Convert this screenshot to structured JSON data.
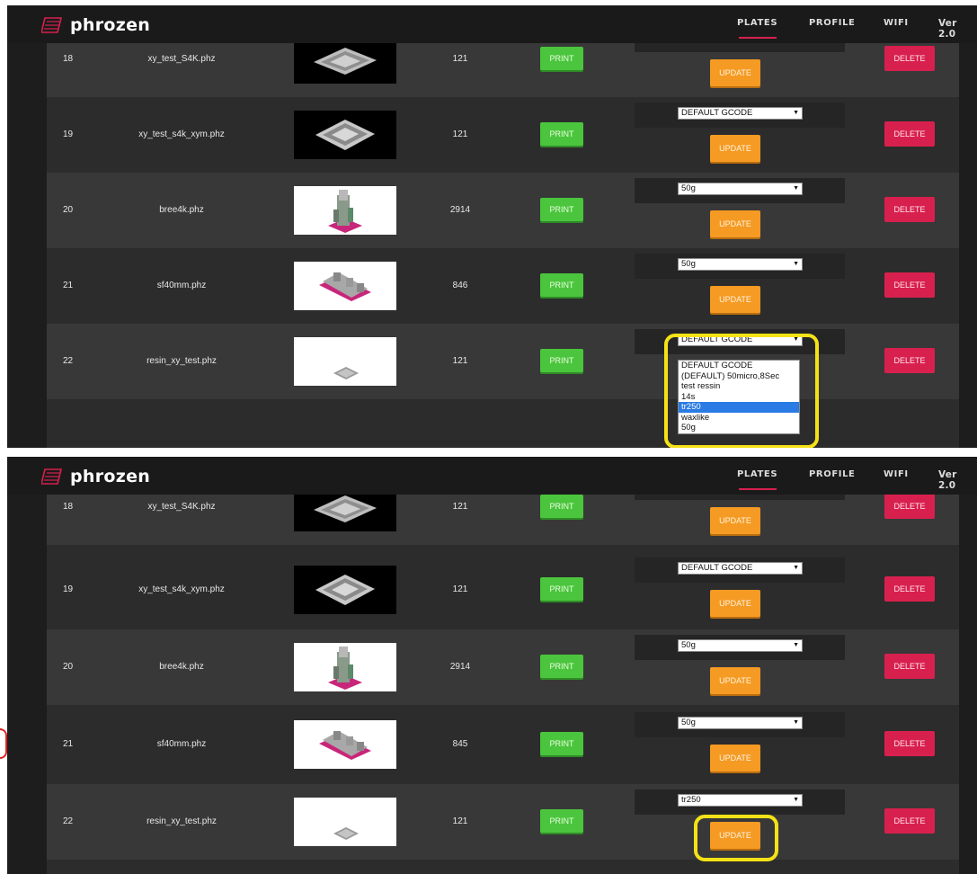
{
  "app": {
    "brand": "phrozen",
    "brand_color": "#d8204e",
    "nav": [
      {
        "label": "PLATES",
        "active": true
      },
      {
        "label": "PROFILE",
        "active": false
      },
      {
        "label": "WIFI",
        "active": false
      }
    ],
    "version": "Ver 2.0"
  },
  "labels": {
    "print": "PRINT",
    "update": "UPDATE",
    "delete": "DELETE"
  },
  "colors": {
    "print": "#4bc53d",
    "update": "#f59a23",
    "delete": "#d8204e",
    "highlight": "#f4e217"
  },
  "top": {
    "rows": [
      {
        "id": "18",
        "name": "xy_test_S4K.phz",
        "size": "121",
        "thumb": "dark-plate",
        "gcode": ""
      },
      {
        "id": "19",
        "name": "xy_test_s4k_xym.phz",
        "size": "121",
        "thumb": "dark-plate",
        "gcode": "DEFAULT GCODE"
      },
      {
        "id": "20",
        "name": "bree4k.phz",
        "size": "2914",
        "thumb": "light-figure",
        "gcode": "50g"
      },
      {
        "id": "21",
        "name": "sf40mm.phz",
        "size": "846",
        "thumb": "light-plate",
        "gcode": "50g"
      },
      {
        "id": "22",
        "name": "resin_xy_test.phz",
        "size": "121",
        "thumb": "light-small",
        "gcode": "DEFAULT GCODE"
      }
    ],
    "dropdown_options": [
      "DEFAULT GCODE",
      "(DEFAULT) 50micro,8Sec",
      "test ressin",
      "14s",
      "tr250",
      "waxlike",
      "50g"
    ],
    "dropdown_selected": "tr250"
  },
  "bottom": {
    "rows": [
      {
        "id": "18",
        "name": "xy_test_S4K.phz",
        "size": "121",
        "thumb": "dark-plate",
        "gcode": ""
      },
      {
        "id": "19",
        "name": "xy_test_s4k_xym.phz",
        "size": "121",
        "thumb": "dark-plate",
        "gcode": "DEFAULT GCODE"
      },
      {
        "id": "20",
        "name": "bree4k.phz",
        "size": "2914",
        "thumb": "light-figure",
        "gcode": "50g"
      },
      {
        "id": "21",
        "name": "sf40mm.phz",
        "size": "845",
        "thumb": "light-plate",
        "gcode": "50g"
      },
      {
        "id": "22",
        "name": "resin_xy_test.phz",
        "size": "121",
        "thumb": "light-small",
        "gcode": "tr250"
      }
    ]
  }
}
